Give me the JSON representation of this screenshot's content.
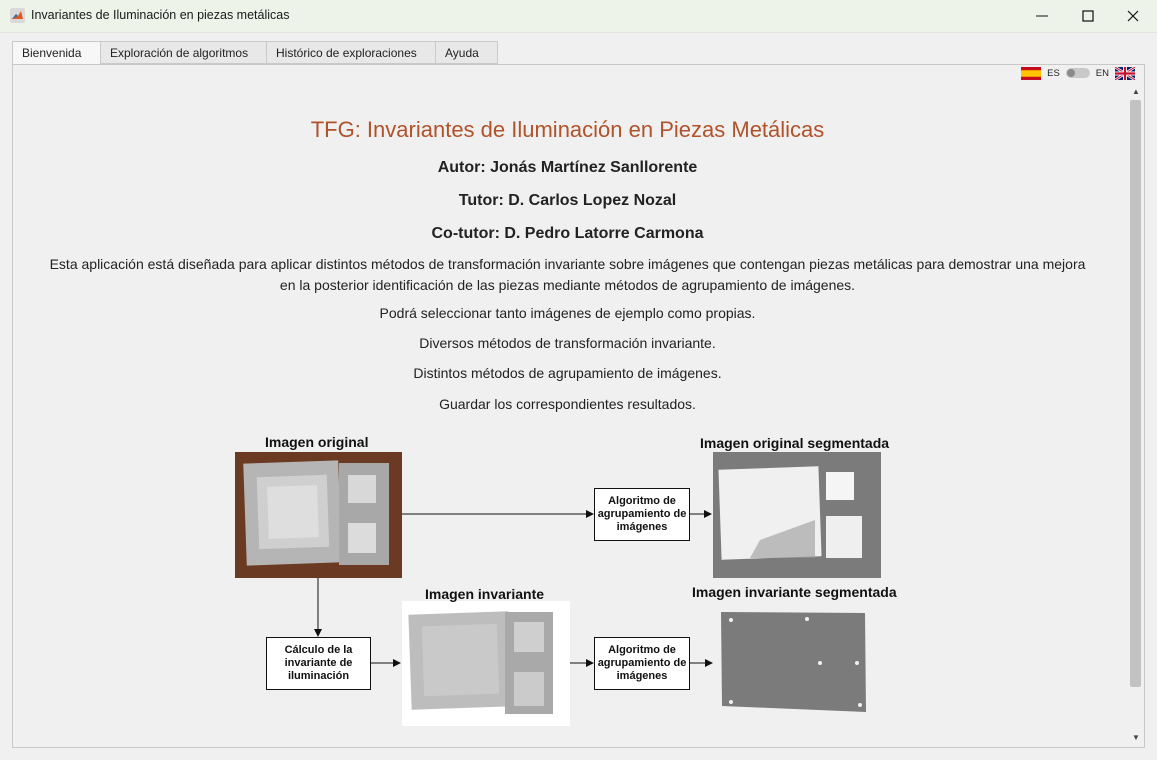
{
  "window": {
    "title": "Invariantes de Iluminación en piezas metálicas"
  },
  "tabs": [
    {
      "label": "Bienvenida",
      "active": true
    },
    {
      "label": "Exploración de algoritmos"
    },
    {
      "label": "Histórico de exploraciones"
    },
    {
      "label": "Ayuda"
    }
  ],
  "language": {
    "es_label": "ES",
    "en_label": "EN"
  },
  "welcome": {
    "title": "TFG: Invariantes de Iluminación en Piezas Metálicas",
    "author": "Autor: Jonás Martínez Sanllorente",
    "tutor": "Tutor: D. Carlos Lopez Nozal",
    "cotutor": "Co-tutor: D. Pedro Latorre Carmona",
    "description": "Esta aplicación está diseñada para aplicar distintos métodos de transformación invariante sobre imágenes que contengan piezas metálicas para demostrar una mejora en la posterior identificación de las piezas mediante métodos de agrupamiento de imágenes.",
    "features": [
      "Podrá seleccionar tanto imágenes de ejemplo como propias.",
      "Diversos métodos de transformación invariante.",
      "Distintos métodos de agrupamiento de imágenes.",
      "Guardar los correspondientes resultados."
    ]
  },
  "diagram": {
    "original_label": "Imagen original",
    "original_segmented_label": "Imagen original segmentada",
    "invariant_label": "Imagen invariante",
    "invariant_segmented_label": "Imagen invariante segmentada",
    "clustering_box": "Algoritmo de agrupamiento de imágenes",
    "invariant_box": "Cálculo de la invariante de iluminación"
  },
  "colors": {
    "title": "#b0522a",
    "wood": "#6b3a22",
    "segmented_gray": "#7b7b7b"
  }
}
